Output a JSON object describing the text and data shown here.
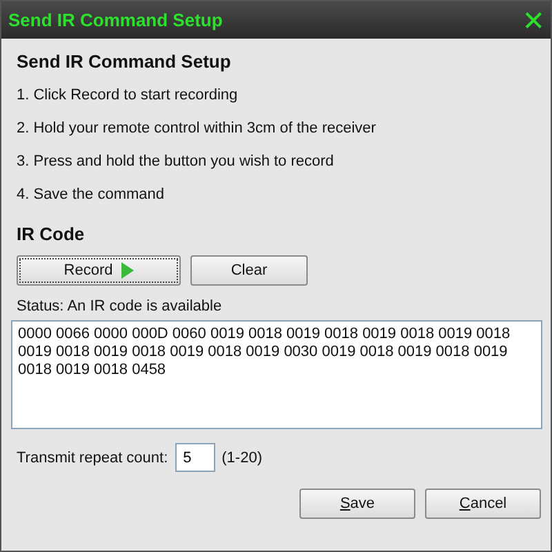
{
  "window": {
    "title": "Send IR Command Setup",
    "close": "✕"
  },
  "heading": "Send IR Command Setup",
  "steps": [
    "1. Click Record to start recording",
    "2. Hold your remote control within 3cm of the receiver",
    "3. Press and hold the button you wish to record",
    "4. Save the command"
  ],
  "ir_code": {
    "heading": "IR Code",
    "buttons": [
      {
        "label": "Record",
        "kind": "play",
        "focused": true
      },
      {
        "label": "Clear",
        "kind": "plain",
        "focused": false
      }
    ],
    "status": "Status: An IR code is available",
    "value": "0000 0066 0000 000D 0060 0019 0018 0019 0018 0019 0018 0019 0018 0019 0018 0019 0018 0019 0018 0019 0030 0019 0018 0019 0018 0019 0018 0019 0018 0458"
  },
  "repeat": {
    "label": "Transmit repeat count:",
    "value": "5",
    "range": "(1-20)"
  },
  "footer_buttons": [
    {
      "access_key": "S",
      "rest": "ave"
    },
    {
      "access_key": "C",
      "rest": "ancel"
    }
  ]
}
